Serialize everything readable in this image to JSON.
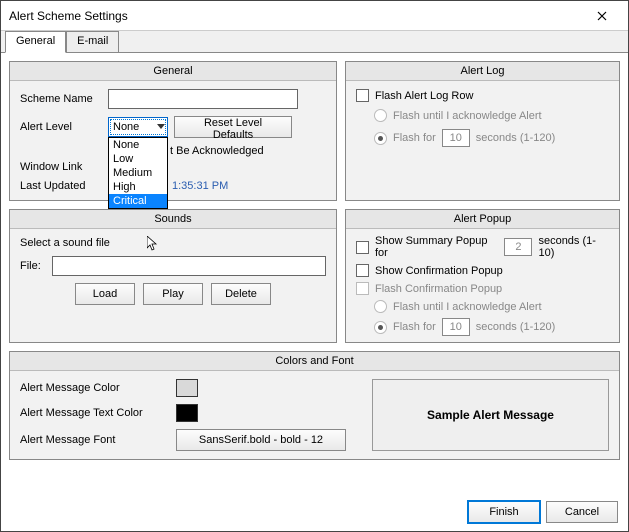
{
  "window": {
    "title": "Alert Scheme Settings"
  },
  "tabs": {
    "general": "General",
    "email": "E-mail"
  },
  "general": {
    "title": "General",
    "scheme_name_label": "Scheme Name",
    "scheme_name_value": "",
    "alert_level_label": "Alert Level",
    "alert_level_selected": "None",
    "alert_level_options": [
      "None",
      "Low",
      "Medium",
      "High",
      "Critical"
    ],
    "reset_defaults": "Reset Level Defaults",
    "must_ack_partial": "t Be Acknowledged",
    "window_link_label": "Window Link",
    "last_updated_label": "Last Updated",
    "last_updated_time": "  1:35:31 PM"
  },
  "alert_log": {
    "title": "Alert Log",
    "flash_row": "Flash Alert Log Row",
    "flash_until": "Flash until I acknowledge Alert",
    "flash_for": "Flash for",
    "flash_for_value": "10",
    "seconds_range": "seconds (1-120)"
  },
  "sounds": {
    "title": "Sounds",
    "select_label": "Select a sound file",
    "file_label": "File:",
    "file_value": "",
    "load": "Load",
    "play": "Play",
    "delete": "Delete"
  },
  "alert_popup": {
    "title": "Alert Popup",
    "show_summary": "Show Summary Popup for",
    "show_summary_value": "2",
    "seconds_range1": "seconds (1-10)",
    "show_confirmation": "Show Confirmation Popup",
    "flash_confirmation": "Flash Confirmation Popup",
    "flash_until": "Flash until I acknowledge Alert",
    "flash_for": "Flash for",
    "flash_for_value": "10",
    "seconds_range2": "seconds (1-120)"
  },
  "colors_font": {
    "title": "Colors and Font",
    "msg_color_label": "Alert Message Color",
    "msg_color": "#d9d9d9",
    "text_color_label": "Alert Message Text Color",
    "text_color": "#000000",
    "font_label": "Alert Message Font",
    "font_button": "SansSerif.bold - bold - 12",
    "sample": "Sample Alert Message"
  },
  "buttons": {
    "finish": "Finish",
    "cancel": "Cancel"
  }
}
